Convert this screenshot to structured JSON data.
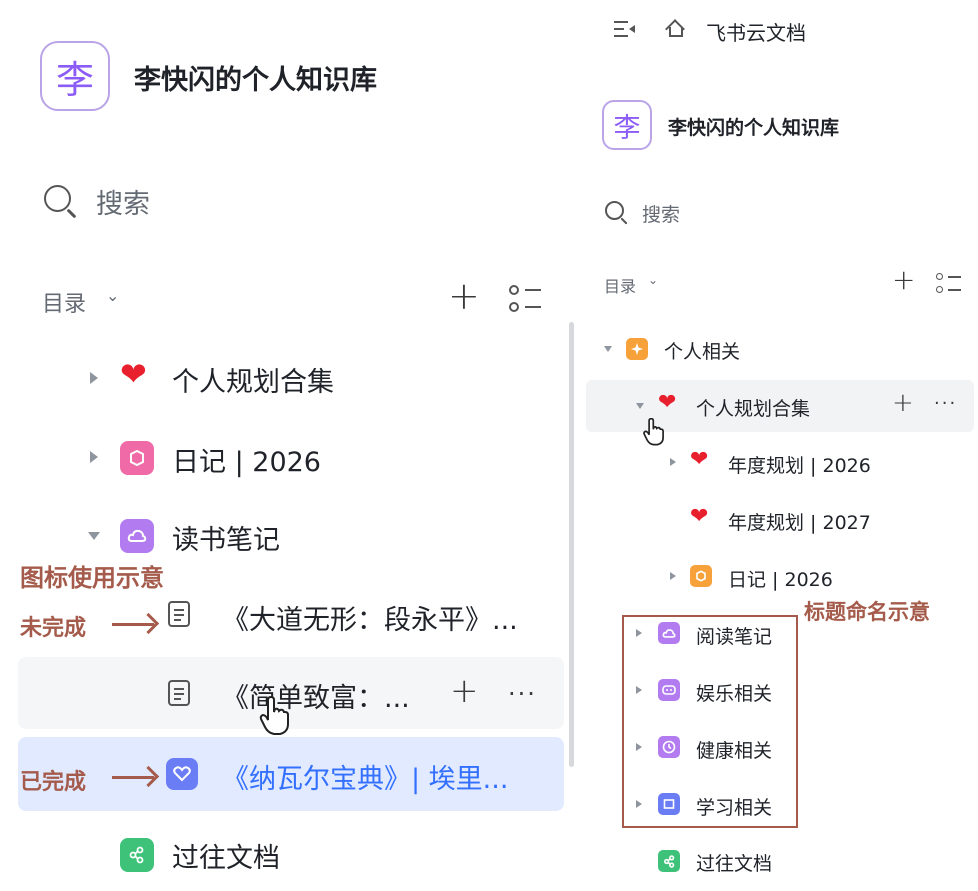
{
  "left_panel": {
    "kb_icon_char": "李",
    "kb_title": "李快闪的个人知识库",
    "search_label": "搜索",
    "toc_label": "目录",
    "toc_chevron": "⌄",
    "plus": "+",
    "more": "···",
    "tree": {
      "personal_plan": "个人规划合集",
      "diary": "日记 | 2026",
      "reading_notes": "读书笔记",
      "doc1": "《大道无形：段永平》...",
      "doc2": "《简单致富：...",
      "doc3": "《纳瓦尔宝典》| 埃里...",
      "past_docs": "过往文档"
    },
    "annotations": {
      "icon_usage": "图标使用示意",
      "not_done": "未完成",
      "done": "已完成"
    }
  },
  "right_panel": {
    "top_title": "飞书云文档",
    "kb_icon_char": "李",
    "kb_title": "李快闪的个人知识库",
    "search_label": "搜索",
    "toc_label": "目录",
    "toc_chevron": "⌄",
    "plus": "+",
    "more": "···",
    "tree": {
      "personal_related": "个人相关",
      "personal_plan": "个人规划合集",
      "annual_2026": "年度规划 | 2026",
      "annual_2027": "年度规划 | 2027",
      "diary": "日记 | 2026",
      "reading_notes": "阅读笔记",
      "entertainment": "娱乐相关",
      "health": "健康相关",
      "study": "学习相关",
      "past_docs": "过往文档"
    },
    "annotation_naming": "标题命名示意"
  },
  "colors": {
    "annotation": "#a55b4b",
    "selected_text": "#3370ff",
    "heart": "#e8202d"
  }
}
